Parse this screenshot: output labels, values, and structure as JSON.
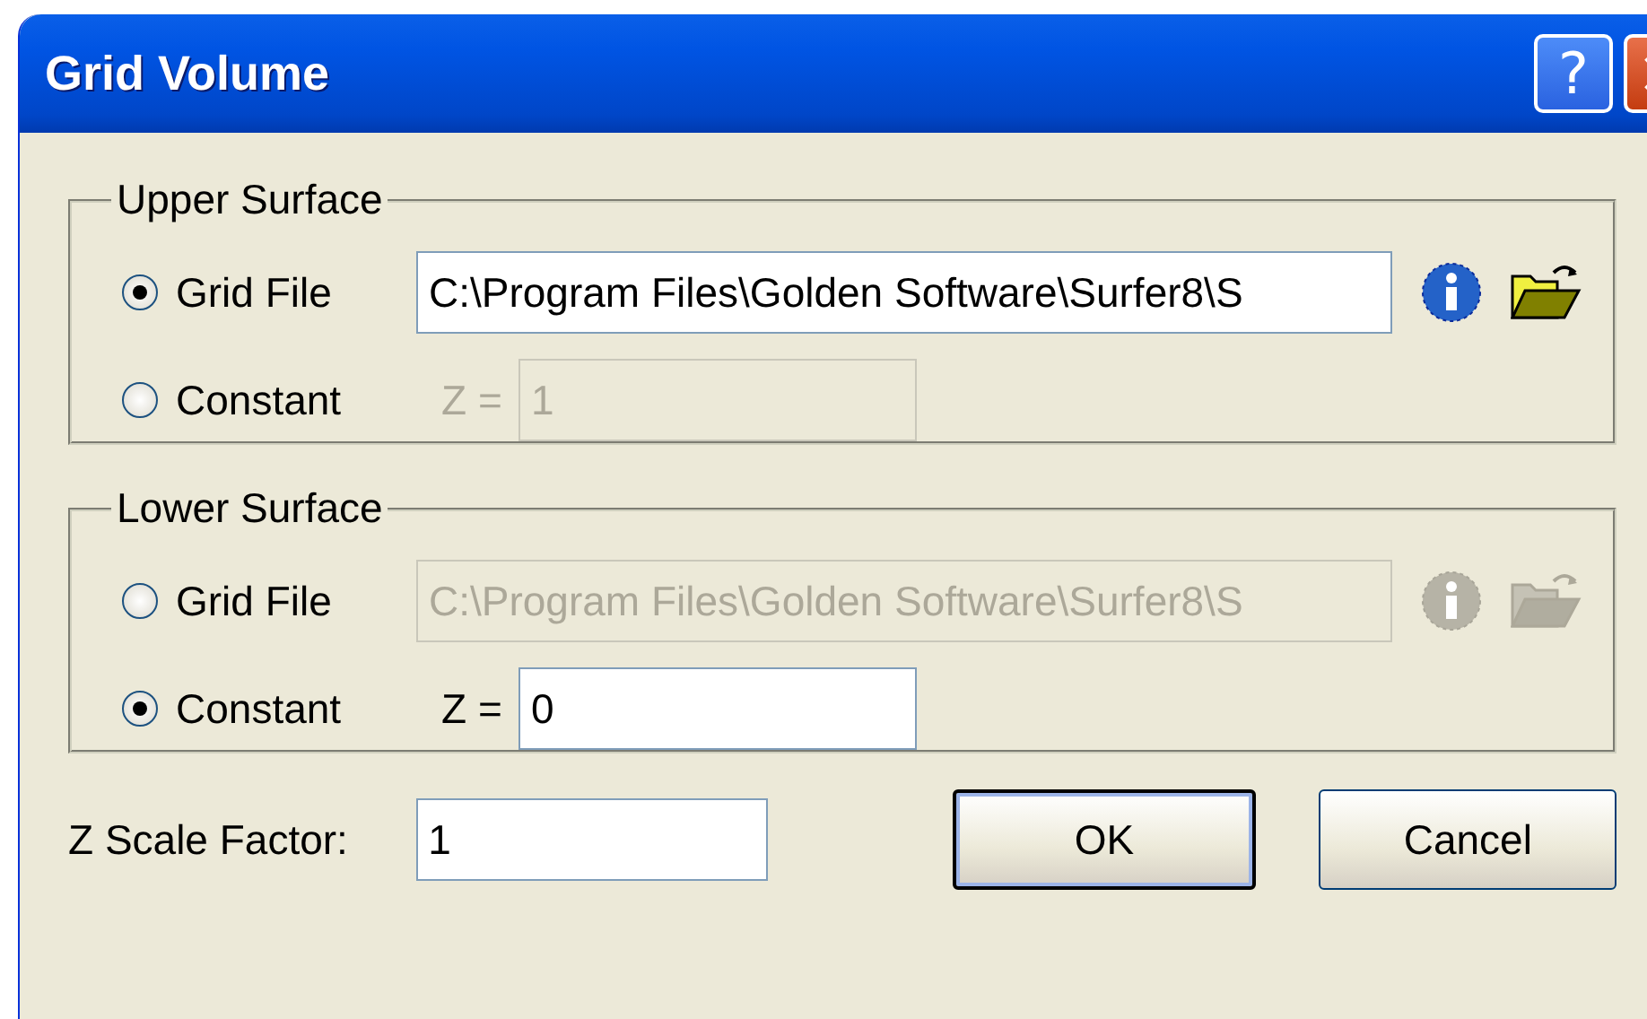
{
  "window": {
    "title": "Grid Volume",
    "help": "?"
  },
  "groups": [
    {
      "title": "Upper Surface",
      "options": [
        {
          "kind": "file",
          "label": "Grid File",
          "selected": true,
          "value": "C:\\Program Files\\Golden Software\\Surfer8\\S"
        },
        {
          "kind": "constant",
          "label": "Constant",
          "selected": false,
          "prefix": "Z =",
          "value": "1"
        }
      ]
    },
    {
      "title": "Lower Surface",
      "options": [
        {
          "kind": "file",
          "label": "Grid File",
          "selected": false,
          "value": "C:\\Program Files\\Golden Software\\Surfer8\\S"
        },
        {
          "kind": "constant",
          "label": "Constant",
          "selected": true,
          "prefix": "Z =",
          "value": "0"
        }
      ]
    }
  ],
  "scale": {
    "label": "Z Scale Factor:",
    "value": "1"
  },
  "buttons": [
    {
      "label": "OK",
      "default": true
    },
    {
      "label": "Cancel",
      "default": false
    }
  ]
}
